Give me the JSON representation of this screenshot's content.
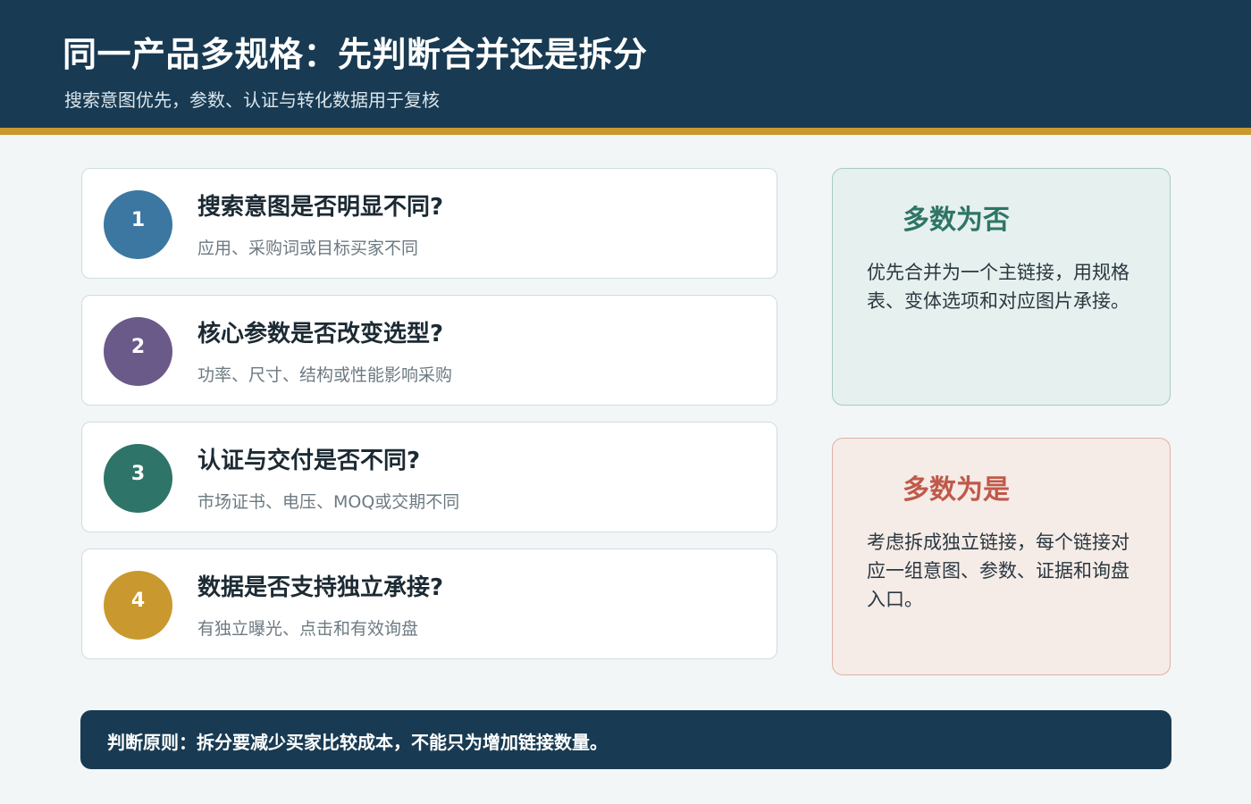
{
  "header": {
    "title": "同一产品多规格：先判断合并还是拆分",
    "subtitle": "搜索意图优先，参数、认证与转化数据用于复核"
  },
  "questions": [
    {
      "number": "1",
      "title": "搜索意图是否明显不同?",
      "description": "应用、采购词或目标买家不同",
      "color": "#3b77a0"
    },
    {
      "number": "2",
      "title": "核心参数是否改变选型?",
      "description": "功率、尺寸、结构或性能影响采购",
      "color": "#6a5a8a"
    },
    {
      "number": "3",
      "title": "认证与交付是否不同?",
      "description": "市场证书、电压、MOQ或交期不同",
      "color": "#2f7468"
    },
    {
      "number": "4",
      "title": "数据是否支持独立承接?",
      "description": "有独立曝光、点击和有效询盘",
      "color": "#c9992f"
    }
  ],
  "outcomes": {
    "no": {
      "title": "多数为否",
      "body": "优先合并为一个主链接，用规格表、变体选项和对应图片承接。",
      "title_color": "#2e7566",
      "bg_color": "#e6f0ee",
      "border_color": "#a7cbc2"
    },
    "yes": {
      "title": "多数为是",
      "body": "考虑拆成独立链接，每个链接对应一组意图、参数、证据和询盘入口。",
      "title_color": "#c0594a",
      "bg_color": "#f5ebe7",
      "border_color": "#e0b0a6"
    }
  },
  "footer": {
    "text": "判断原则：拆分要减少买家比较成本，不能只为增加链接数量。"
  }
}
